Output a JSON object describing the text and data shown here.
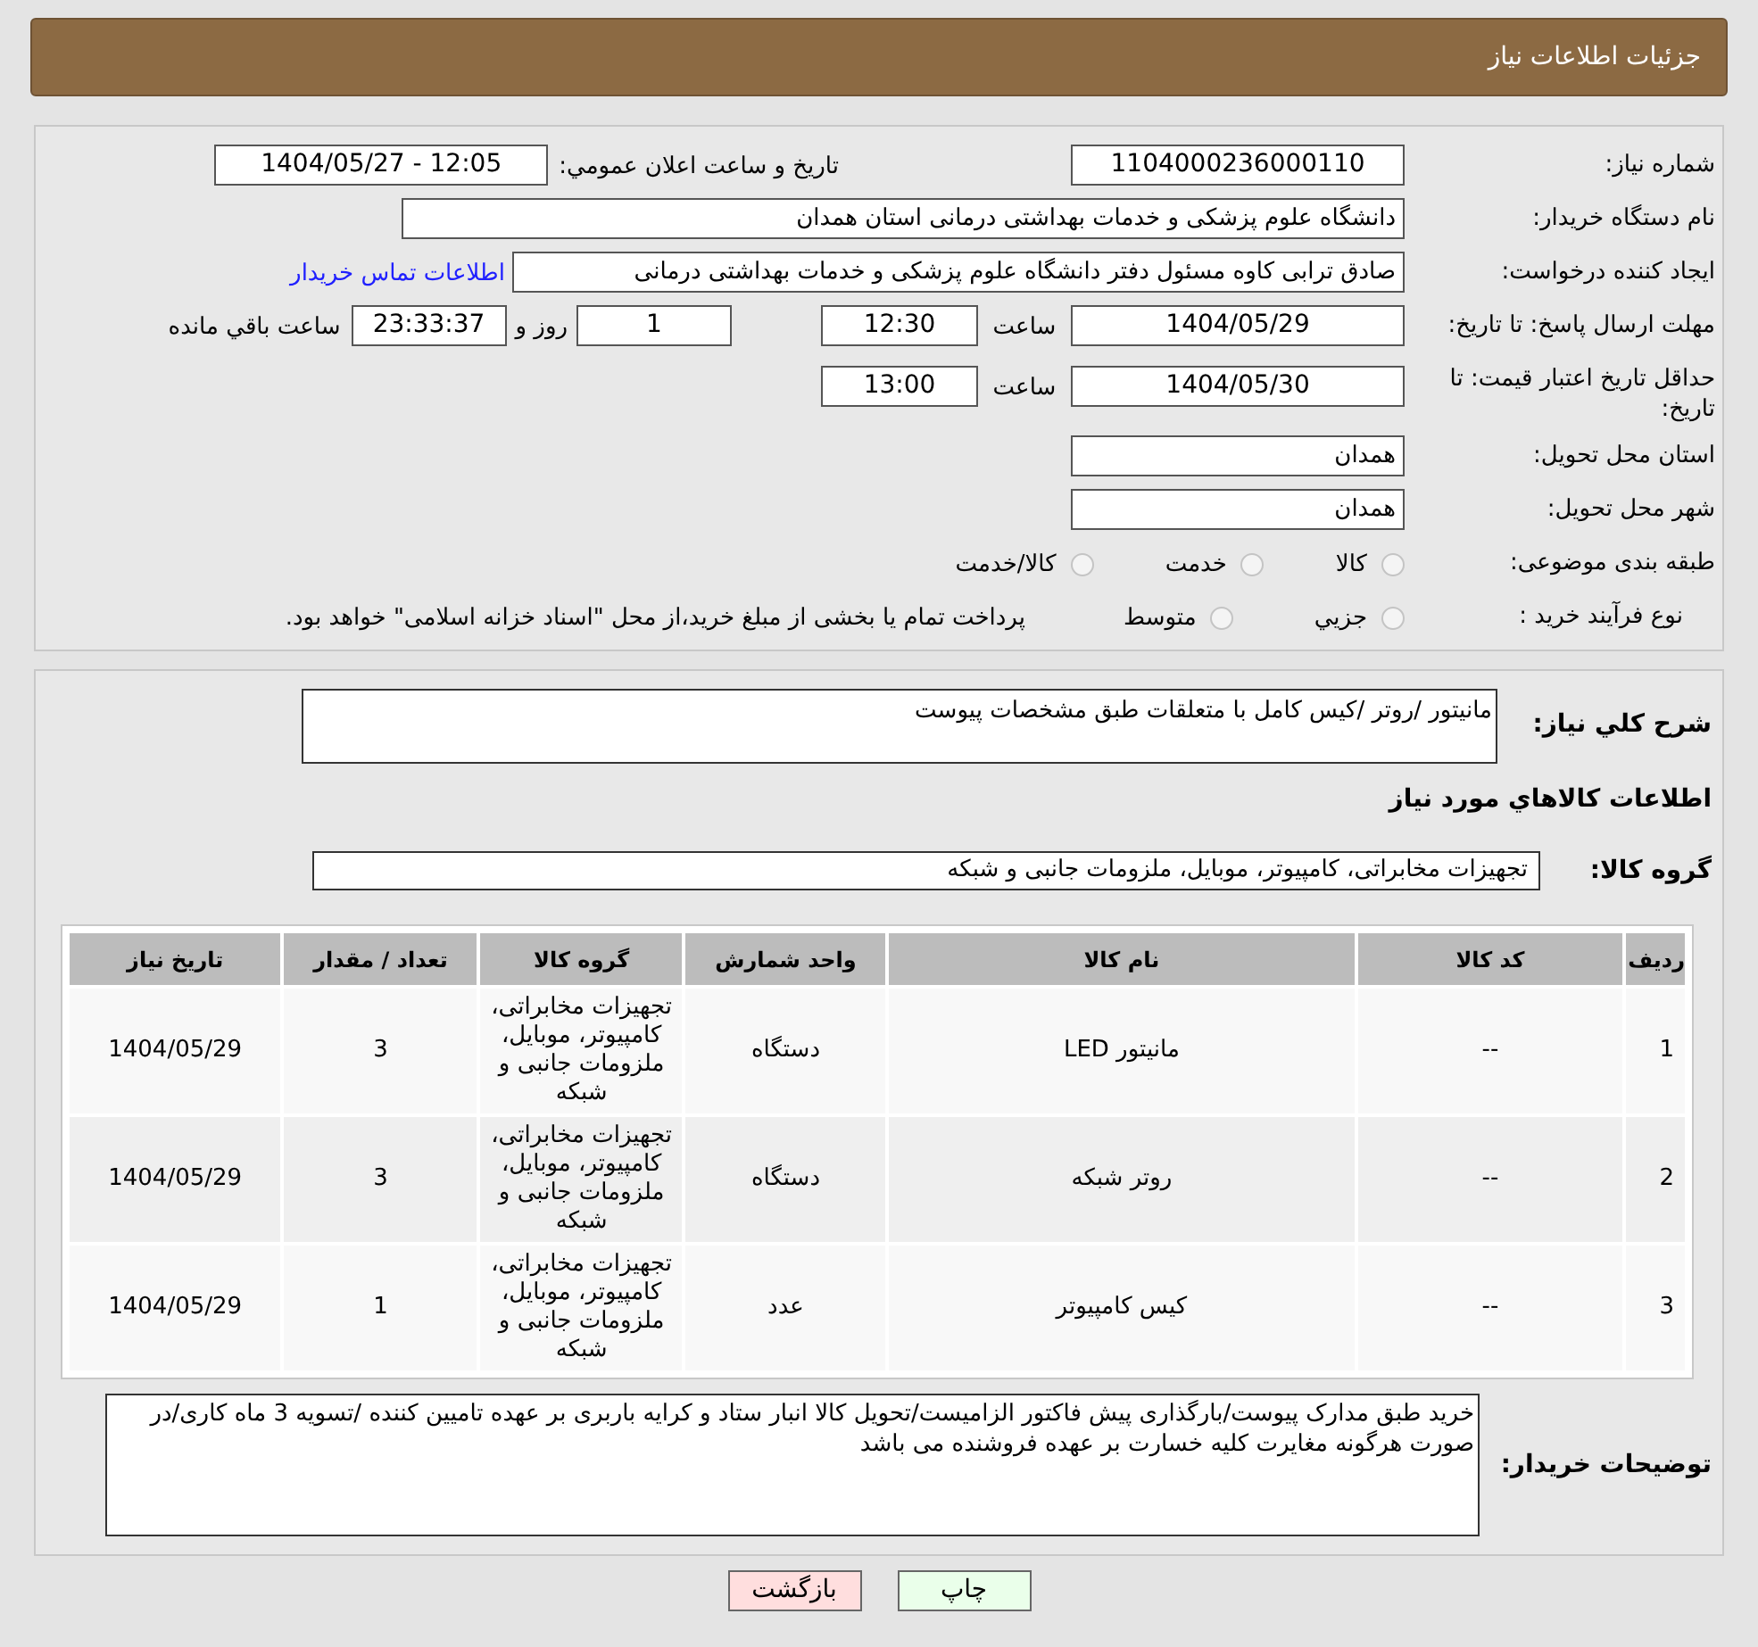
{
  "header": {
    "title": "جزئیات اطلاعات نیاز"
  },
  "need_number": {
    "label": "شماره نیاز:",
    "value": "1104000236000110"
  },
  "announce": {
    "label": "تاریخ و ساعت اعلان عمومي:",
    "value": "1404/05/27 - 12:05"
  },
  "buyer_org": {
    "label": "نام دستگاه خریدار:",
    "value": "دانشگاه علوم پزشکی و خدمات بهداشتی درمانی استان همدان"
  },
  "requester": {
    "label": "ایجاد کننده درخواست:",
    "value": "صادق ترابی کاوه مسئول دفتر دانشگاه علوم پزشکی و خدمات بهداشتی درمانی",
    "link": "اطلاعات تماس خریدار"
  },
  "reply_deadline": {
    "label": "مهلت ارسال پاسخ: تا تاریخ:",
    "date": "1404/05/29",
    "time_label": "ساعت",
    "time": "12:30",
    "days": "1",
    "days_label": "روز و",
    "remaining": "23:33:37",
    "remaining_label": "ساعت باقي مانده"
  },
  "price_validity": {
    "label": "حداقل تاریخ اعتبار قیمت: تا تاریخ:",
    "date": "1404/05/30",
    "time_label": "ساعت",
    "time": "13:00"
  },
  "province": {
    "label": "استان محل تحویل:",
    "value": "همدان"
  },
  "city": {
    "label": "شهر محل تحویل:",
    "value": "همدان"
  },
  "category": {
    "label": "طبقه بندی موضوعی:",
    "options": [
      {
        "label": "کالا",
        "selected": false
      },
      {
        "label": "خدمت",
        "selected": false
      },
      {
        "label": "کالا/خدمت",
        "selected": false
      }
    ]
  },
  "purchase_type": {
    "label": "نوع فرآیند خرید :",
    "options": [
      {
        "label": "جزیي",
        "selected": false
      },
      {
        "label": "متوسط",
        "selected": false
      }
    ],
    "note": "پرداخت تمام یا بخشی از مبلغ خرید،از محل \"اسناد خزانه اسلامی\" خواهد بود."
  },
  "description": {
    "label": "شرح کلي نیاز:",
    "value": "مانیتور /روتر /کیس کامل با متعلقات طبق مشخصات پیوست"
  },
  "goods_title": "اطلاعات کالاهاي مورد نیاز",
  "goods_group": {
    "label": "گروه کالا:",
    "value": "تجهیزات مخابراتی، کامپیوتر، موبایل، ملزومات جانبی و شبکه"
  },
  "table": {
    "columns": [
      "ردیف",
      "کد کالا",
      "نام کالا",
      "واحد شمارش",
      "گروه کالا",
      "تعداد / مقدار",
      "تاریخ نیاز"
    ],
    "rows": [
      [
        "1",
        "--",
        "مانیتور LED",
        "دستگاه",
        "تجهیزات مخابراتی، کامپیوتر، موبایل، ملزومات جانبی و شبکه",
        "3",
        "1404/05/29"
      ],
      [
        "2",
        "--",
        "روتر شبکه",
        "دستگاه",
        "تجهیزات مخابراتی، کامپیوتر، موبایل، ملزومات جانبی و شبکه",
        "3",
        "1404/05/29"
      ],
      [
        "3",
        "--",
        "کیس کامپیوتر",
        "عدد",
        "تجهیزات مخابراتی، کامپیوتر، موبایل، ملزومات جانبی و شبکه",
        "1",
        "1404/05/29"
      ]
    ]
  },
  "buyer_notes": {
    "label": "توضیحات خریدار:",
    "value": "خرید طبق مدارک پیوست/بارگذاری پیش فاکتور الزامیست/تحویل کالا انبار ستاد و کرایه باربری بر عهده تامیین کننده /تسویه 3 ماه کاری/در صورت هرگونه مغایرت کلیه خسارت بر عهده فروشنده می باشد"
  },
  "buttons": [
    {
      "label": "چاپ",
      "kind": "print"
    },
    {
      "label": "بازگشت",
      "kind": "back"
    }
  ]
}
